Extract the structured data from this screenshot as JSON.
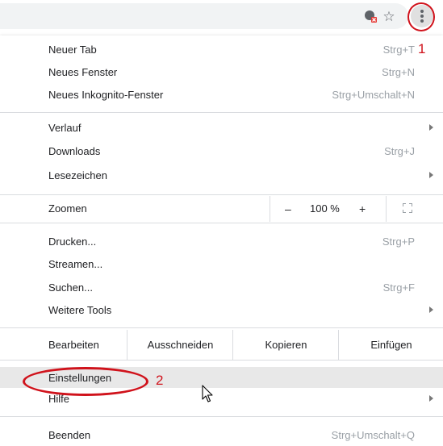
{
  "toolbar": {
    "icons": [
      "extension-icon",
      "bookmark-star-icon",
      "three-dot-menu-icon"
    ],
    "star_glyph": "☆"
  },
  "annotations": {
    "marker_1": "1",
    "marker_2": "2",
    "color": "#d0121b"
  },
  "menu": {
    "group1": [
      {
        "label": "Neuer Tab",
        "shortcut": "Strg+T"
      },
      {
        "label": "Neues Fenster",
        "shortcut": "Strg+N"
      },
      {
        "label": "Neues Inkognito-Fenster",
        "shortcut": "Strg+Umschalt+N"
      }
    ],
    "group2": [
      {
        "label": "Verlauf",
        "shortcut": "",
        "submenu": true
      },
      {
        "label": "Downloads",
        "shortcut": "Strg+J"
      },
      {
        "label": "Lesezeichen",
        "shortcut": "",
        "submenu": true
      }
    ],
    "zoom": {
      "label": "Zoomen",
      "minus": "–",
      "level": "100 %",
      "plus": "+"
    },
    "group4": [
      {
        "label": "Drucken...",
        "shortcut": "Strg+P"
      },
      {
        "label": "Streamen...",
        "shortcut": ""
      },
      {
        "label": "Suchen...",
        "shortcut": "Strg+F"
      },
      {
        "label": "Weitere Tools",
        "shortcut": "",
        "submenu": true
      }
    ],
    "edit": {
      "label": "Bearbeiten",
      "cut": "Ausschneiden",
      "copy": "Kopieren",
      "paste": "Einfügen"
    },
    "group6": [
      {
        "label": "Einstellungen",
        "shortcut": "",
        "highlighted": true
      },
      {
        "label": "Hilfe",
        "shortcut": "",
        "submenu": true
      }
    ],
    "group7": [
      {
        "label": "Beenden",
        "shortcut": "Strg+Umschalt+Q"
      }
    ]
  }
}
